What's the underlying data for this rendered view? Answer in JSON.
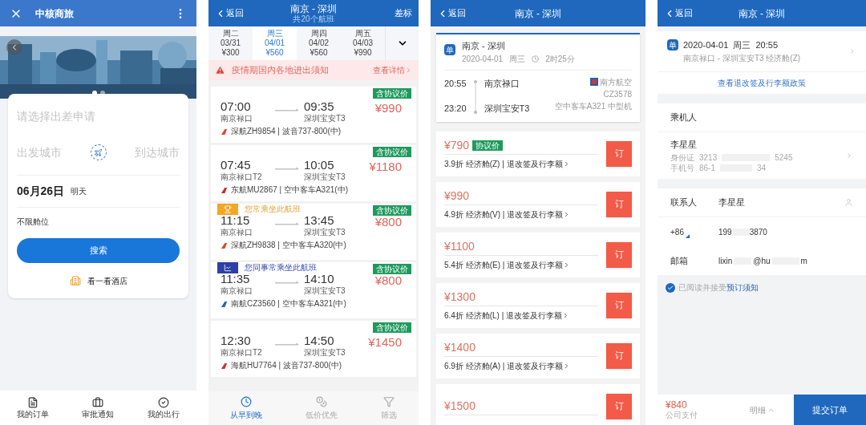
{
  "home": {
    "title": "中核商旅",
    "carousel": [
      {
        "selected": true
      },
      {
        "selected": false
      }
    ],
    "trip_request": {
      "placeholder": "请选择出差申请"
    },
    "from_city": {
      "placeholder": "出发城市"
    },
    "to_city": {
      "placeholder": "到达城市"
    },
    "date": "06月26日",
    "date_note": "明天",
    "cabin": "不限舱位",
    "search_button": "搜索",
    "hotel_link": "看一看酒店",
    "bottom_nav": [
      {
        "kind": "orders",
        "label": "我的订单"
      },
      {
        "kind": "approval",
        "label": "审批通知"
      },
      {
        "kind": "trips",
        "label": "我的出行"
      }
    ]
  },
  "flight_list": {
    "back": "返回",
    "title": "南京 - 深圳",
    "subtitle": "共20个航班",
    "action": "差标",
    "dates": [
      {
        "weekday": "周二",
        "date": "03/31",
        "price": "¥300",
        "selected": false
      },
      {
        "weekday": "周三",
        "date": "04/01",
        "price": "¥560",
        "selected": true
      },
      {
        "weekday": "周四",
        "date": "04/02",
        "price": "¥560",
        "selected": false
      },
      {
        "weekday": "周五",
        "date": "04/03",
        "price": "¥990",
        "selected": false
      }
    ],
    "notice": {
      "text": "疫情期国内各地进出须知",
      "link": "查看详情"
    },
    "flights": [
      {
        "dep_time": "07:00",
        "arr_time": "09:35",
        "dep_airport": "南京禄口",
        "arr_airport": "深圳宝安T3",
        "price": "¥990",
        "tag": "含协议价",
        "airline": "深航ZH9854 | 波音737-800(中)",
        "color": "#e0452c"
      },
      {
        "dep_time": "07:45",
        "arr_time": "10:05",
        "dep_airport": "南京禄口T2",
        "arr_airport": "深圳宝安T3",
        "price": "¥1180",
        "tag": "含协议价",
        "airline": "东航MU2867 | 空中客车A321(中)",
        "color": "#c8262f"
      },
      {
        "banner": {
          "kind": "frequent",
          "text": "您常乘坐此航班"
        },
        "dep_time": "11:15",
        "arr_time": "13:45",
        "dep_airport": "南京禄口",
        "arr_airport": "深圳宝安T3",
        "price": "¥800",
        "tag": "含协议价",
        "airline": "深航ZH9838 | 空中客车A320(中)",
        "color": "#e0452c"
      },
      {
        "banner": {
          "kind": "colleague",
          "text": "您同事常乘坐此航班"
        },
        "dep_time": "11:35",
        "arr_time": "14:10",
        "dep_airport": "南京禄口",
        "arr_airport": "深圳宝安T3",
        "price": "¥800",
        "tag": "含协议价",
        "airline": "南航CZ3560 | 空中客车A321(中)",
        "color": "#2a5fa8"
      },
      {
        "dep_time": "12:30",
        "arr_time": "14:50",
        "dep_airport": "南京禄口T2",
        "arr_airport": "深圳宝安T3",
        "price": "¥1450",
        "tag": "含协议价",
        "airline": "海航HU7764 | 波音737-800(中)",
        "color": "#d42c2c"
      }
    ],
    "tabs": [
      {
        "kind": "time",
        "label": "从早到晚",
        "selected": true
      },
      {
        "kind": "price",
        "label": "低价优先",
        "selected": false
      },
      {
        "kind": "filter",
        "label": "筛选",
        "selected": false
      }
    ]
  },
  "fares": {
    "back": "返回",
    "title": "南京 - 深圳",
    "trip": {
      "badge": "单",
      "route": "南京 - 深圳",
      "date": "2020-04-01",
      "weekday": "周三",
      "duration": "2时25分",
      "dep_time": "20:55",
      "dep_airport": "南京禄口",
      "arr_time": "23:20",
      "arr_airport": "深圳宝安T3",
      "airline": "南方航空",
      "flight_no": "CZ3578",
      "aircraft": "空中客车A321 中型机"
    },
    "options": [
      {
        "price": "¥790",
        "tag": "协议价",
        "detail": "3.9折 经济舱(Z) | 退改签及行李额",
        "button": "订"
      },
      {
        "price": "¥990",
        "detail": "4.9折 经济舱(V) | 退改签及行李额",
        "button": "订"
      },
      {
        "price": "¥1100",
        "detail": "5.4折 经济舱(E) | 退改签及行李额",
        "button": "订"
      },
      {
        "price": "¥1300",
        "detail": "6.4折 经济舱(L) | 退改签及行李额",
        "button": "订"
      },
      {
        "price": "¥1400",
        "detail": "6.9折 经济舱(A) | 退改签及行李额",
        "button": "订"
      },
      {
        "price": "¥1500",
        "button": "订"
      }
    ]
  },
  "booking": {
    "back": "返回",
    "title": "南京 - 深圳",
    "trip": {
      "badge": "单",
      "datetime": "2020-04-01  周三  20:55",
      "detail": "南京禄口 - 深圳宝安T3 经济舱(Z)"
    },
    "policy_link": "查看退改签及行李额政策",
    "passengers_header": "乘机人",
    "passenger": {
      "name": "李星星",
      "id_label": "身份证",
      "id_start": "3213",
      "id_end": "5245",
      "phone_label": "手机号",
      "phone_start": "86-1",
      "phone_end": "34"
    },
    "contact": {
      "label": "联系人",
      "name": "李星星"
    },
    "phone": {
      "code": "+86",
      "start": "199",
      "end": "3870"
    },
    "email": {
      "label": "邮箱",
      "start": "lixin",
      "middle": "@hu",
      "end": "m"
    },
    "agreement": {
      "checked": true,
      "text": "已阅读并接受",
      "link": "预订须知"
    },
    "footer": {
      "price": "¥840",
      "note": "公司支付",
      "detail": "明细",
      "submit": "提交订单"
    }
  }
}
